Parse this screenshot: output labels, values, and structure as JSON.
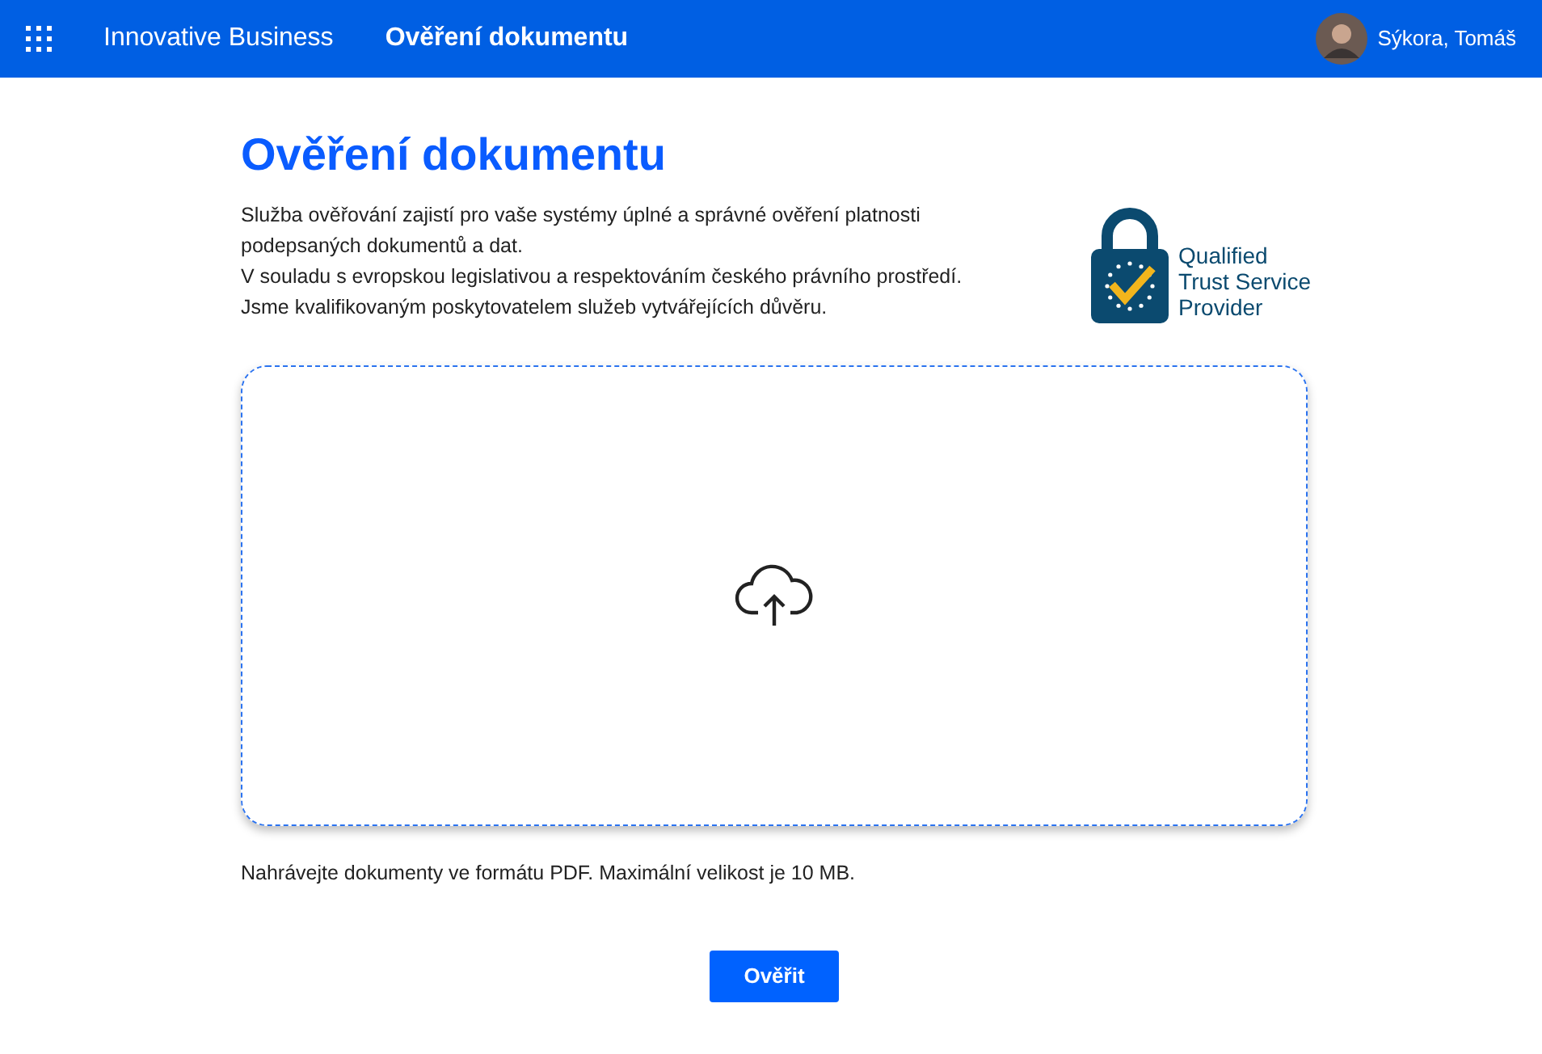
{
  "header": {
    "brand": "Innovative Business",
    "page": "Ověření dokumentu",
    "user": "Sýkora, Tomáš"
  },
  "title": "Ověření dokumentu",
  "paragraphs": [
    "Služba ověřování zajistí pro vaše systémy úplné a správné ověření platnosti podepsaných dokumentů a dat.",
    "V souladu s evropskou legislativou a respektováním českého právního prostředí.",
    "Jsme kvalifikovaným poskytovatelem služeb vytvářejících důvěru."
  ],
  "badge": {
    "lines": [
      "Qualified",
      "Trust Service",
      "Provider"
    ]
  },
  "hint": "Nahrávejte dokumenty ve formátu PDF. Maximální velikost je 10 MB.",
  "button": "Ověřit"
}
